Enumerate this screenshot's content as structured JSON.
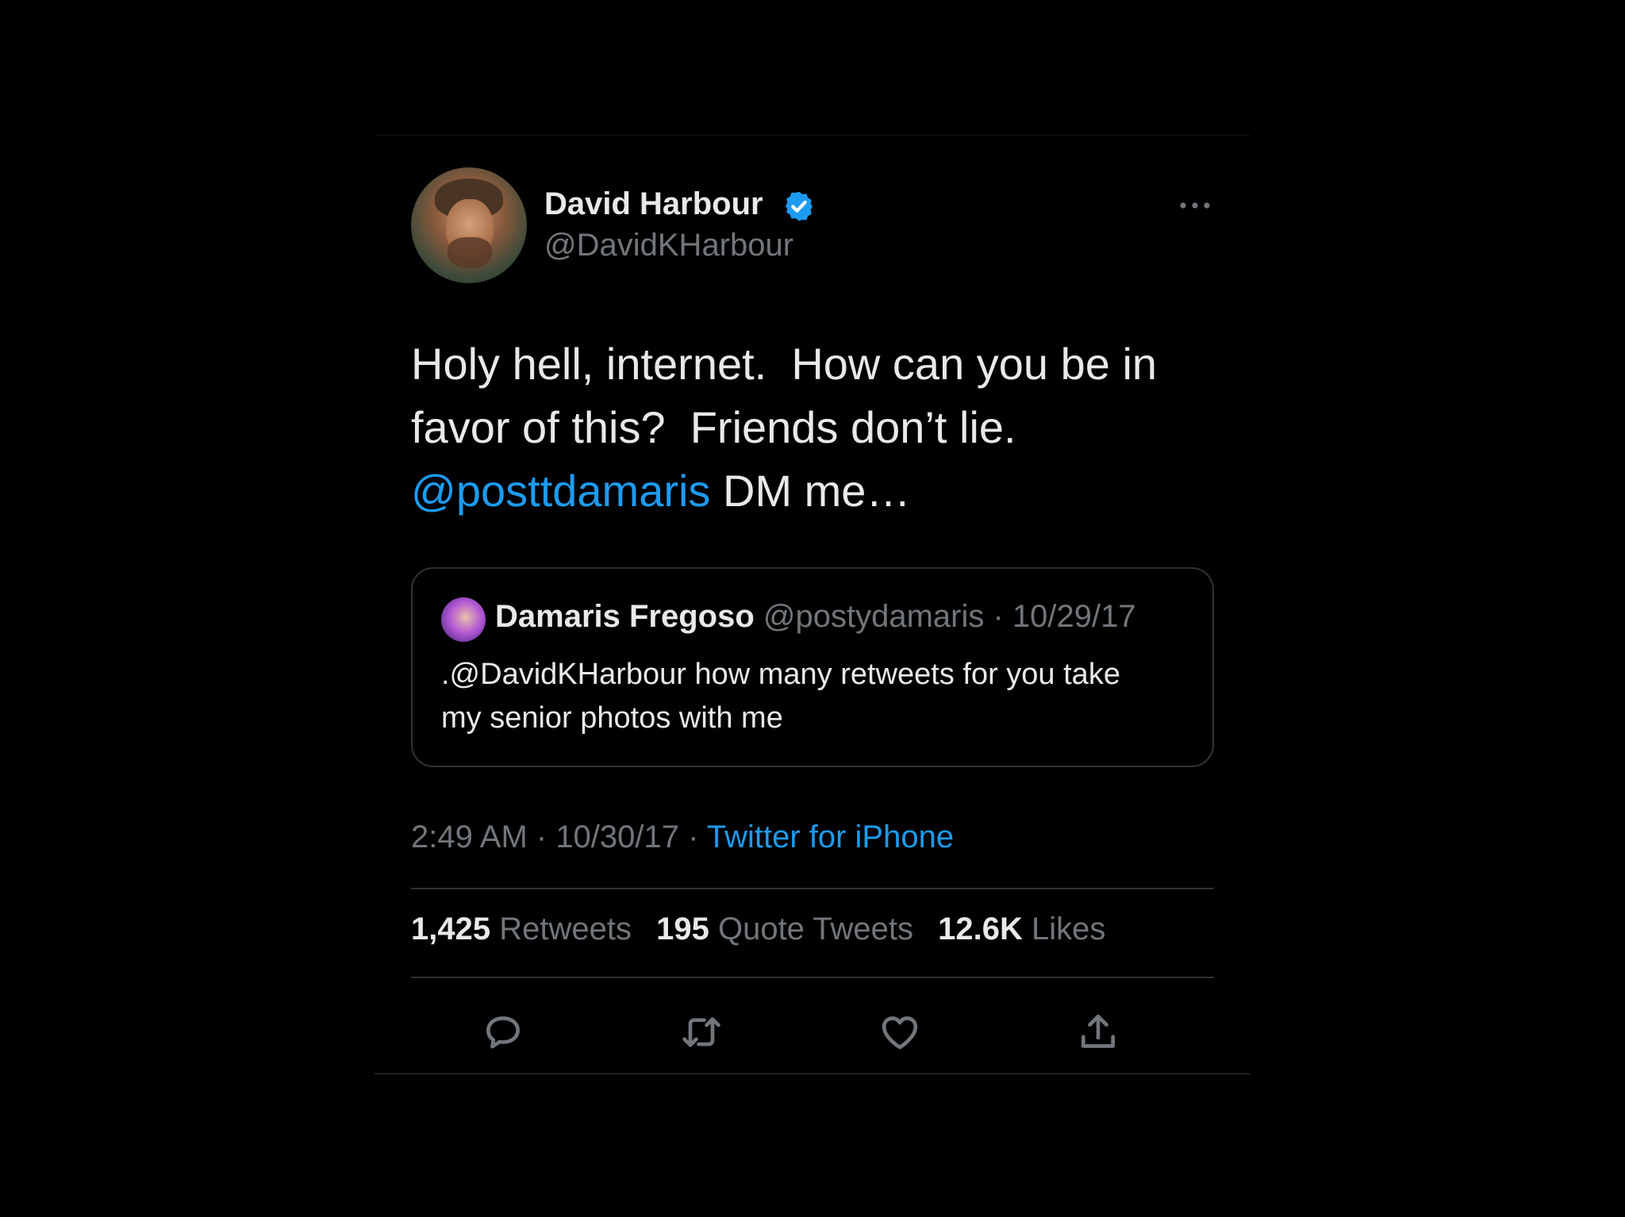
{
  "author": {
    "name": "David Harbour",
    "handle": "@DavidKHarbour",
    "verified": true
  },
  "tweet": {
    "text_line1": "Holy hell, internet.  How can you be in",
    "text_line2": "favor of this?  Friends don’t lie.",
    "mention": "@posttdamaris",
    "text_after_mention": " DM me…"
  },
  "quoted_tweet": {
    "name": "Damaris Fregoso",
    "handle": "@postydamaris",
    "separator": " · ",
    "date": "10/29/17",
    "text": ".@DavidKHarbour how many retweets for you take my senior photos with me"
  },
  "meta": {
    "time": "2:49 AM",
    "separator": " · ",
    "date": "10/30/17",
    "source": "Twitter for iPhone"
  },
  "stats": {
    "retweets_count": "1,425",
    "retweets_label": " Retweets",
    "quotes_count": "195",
    "quotes_label": " Quote Tweets",
    "likes_count": "12.6K",
    "likes_label": " Likes"
  },
  "actions": [
    "reply-icon",
    "retweet-icon",
    "like-icon",
    "share-icon"
  ],
  "colors": {
    "background": "#000000",
    "text": "#e7e9ea",
    "secondary": "#71767b",
    "accent": "#1d9bf0",
    "border": "#2f3336"
  }
}
